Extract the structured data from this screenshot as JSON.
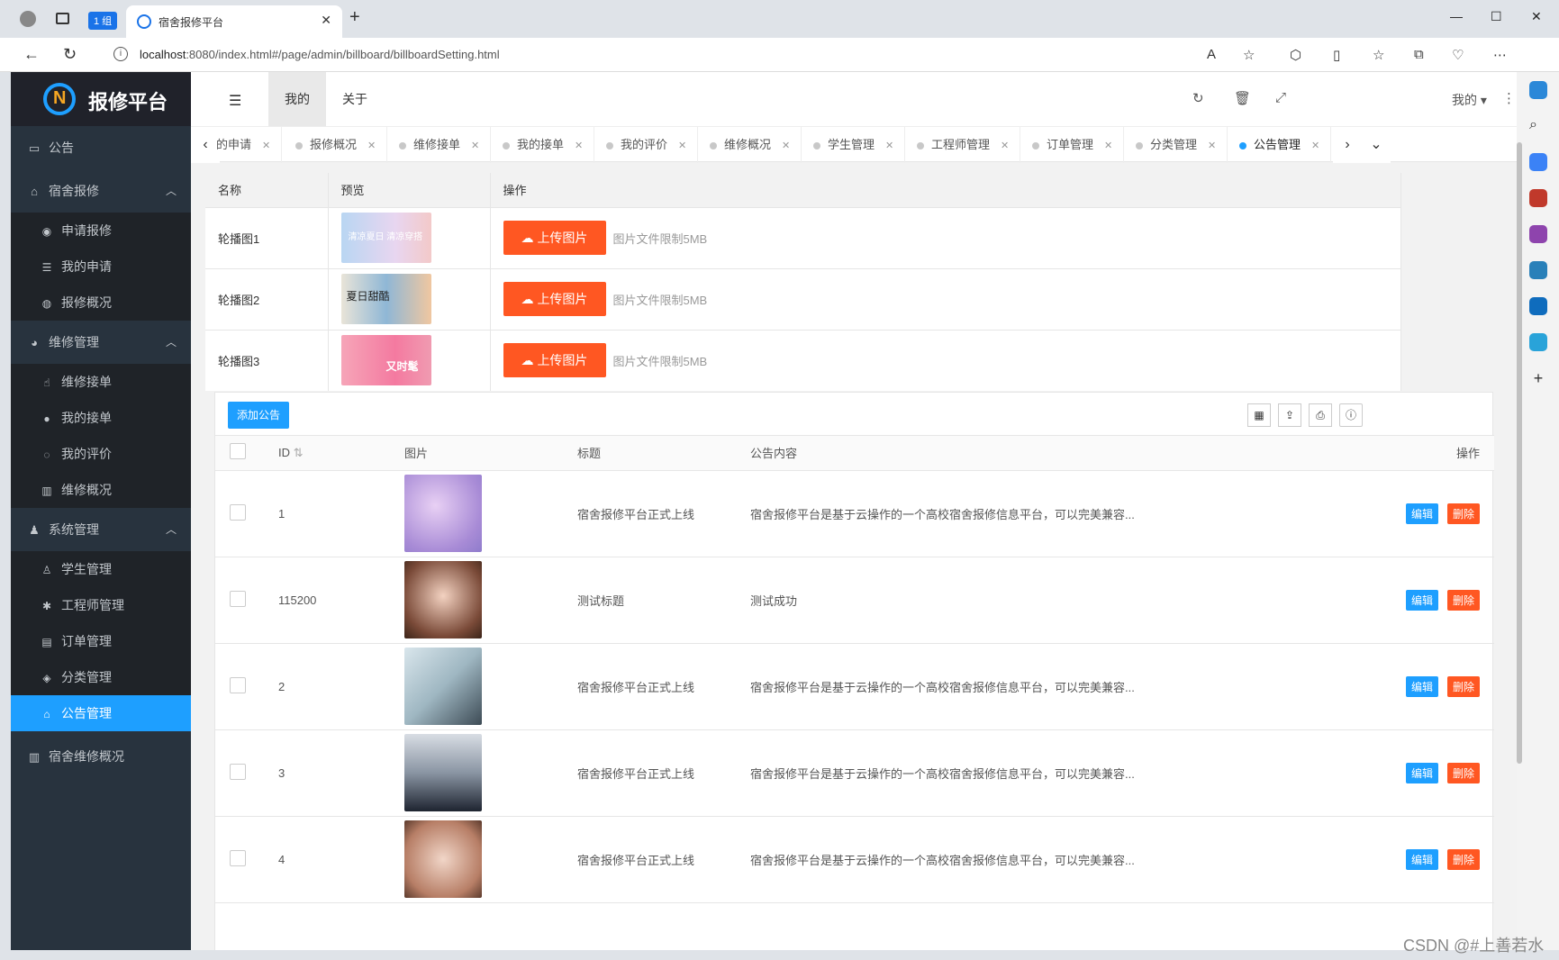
{
  "browser": {
    "group_label": "1 组",
    "tab_title": "宿舍报修平台",
    "url_host": "localhost",
    "url_path": ":8080/index.html#/page/admin/billboard/billboardSetting.html"
  },
  "app": {
    "logo_text": "报修平台",
    "sidebar": {
      "notice": "公告",
      "dorm_repair": "宿舍报修",
      "dorm_repair_items": [
        "申请报修",
        "我的申请",
        "报修概况"
      ],
      "maintenance": "维修管理",
      "maintenance_items": [
        "维修接单",
        "我的接单",
        "我的评价",
        "维修概况"
      ],
      "system": "系统管理",
      "system_items": [
        "学生管理",
        "工程师管理",
        "订单管理",
        "分类管理",
        "公告管理"
      ],
      "overview": "宿舍维修概况"
    },
    "header": {
      "tabs": [
        "我的",
        "关于"
      ],
      "user": "我的"
    },
    "page_tabs": [
      "的申请",
      "报修概况",
      "维修接单",
      "我的接单",
      "我的评价",
      "维修概况",
      "学生管理",
      "工程师管理",
      "订单管理",
      "分类管理",
      "公告管理"
    ],
    "banner": {
      "headers": [
        "名称",
        "预览",
        "操作"
      ],
      "rows": [
        {
          "name": "轮播图1",
          "thumb_text": "清凉夏日 清凉穿搭"
        },
        {
          "name": "轮播图2",
          "thumb_text": "夏日甜酷"
        },
        {
          "name": "轮播图3",
          "thumb_text": "又时髦"
        }
      ],
      "upload_label": "上传图片",
      "upload_hint": "图片文件限制5MB"
    },
    "list": {
      "add_label": "添加公告",
      "headers": {
        "id": "ID",
        "image": "图片",
        "title": "标题",
        "content": "公告内容",
        "action": "操作"
      },
      "edit_label": "编辑",
      "delete_label": "删除",
      "rows": [
        {
          "id": "1",
          "title": "宿舍报修平台正式上线",
          "content": "宿舍报修平台是基于云操作的一个高校宿舍报修信息平台，可以完美兼容..."
        },
        {
          "id": "115200",
          "title": "测试标题",
          "content": "测试成功"
        },
        {
          "id": "2",
          "title": "宿舍报修平台正式上线",
          "content": "宿舍报修平台是基于云操作的一个高校宿舍报修信息平台，可以完美兼容..."
        },
        {
          "id": "3",
          "title": "宿舍报修平台正式上线",
          "content": "宿舍报修平台是基于云操作的一个高校宿舍报修信息平台，可以完美兼容..."
        },
        {
          "id": "4",
          "title": "宿舍报修平台正式上线",
          "content": "宿舍报修平台是基于云操作的一个高校宿舍报修信息平台，可以完美兼容..."
        }
      ]
    }
  },
  "watermark": "CSDN @#上善若水"
}
